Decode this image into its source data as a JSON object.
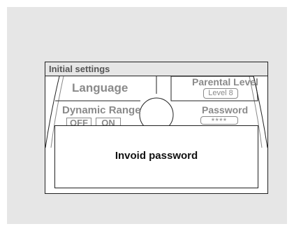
{
  "screen": {
    "title": "Initial settings"
  },
  "menu": {
    "language_label": "Language",
    "dynamic_range_label": "Dynamic Range",
    "dynamic_range_off": "OFF",
    "dynamic_range_on": "ON",
    "parental_level_label": "Parental Level",
    "parental_level_value": "Level 8",
    "password_label": "Password",
    "password_value": "****"
  },
  "dialog": {
    "message": "Invoid password"
  }
}
